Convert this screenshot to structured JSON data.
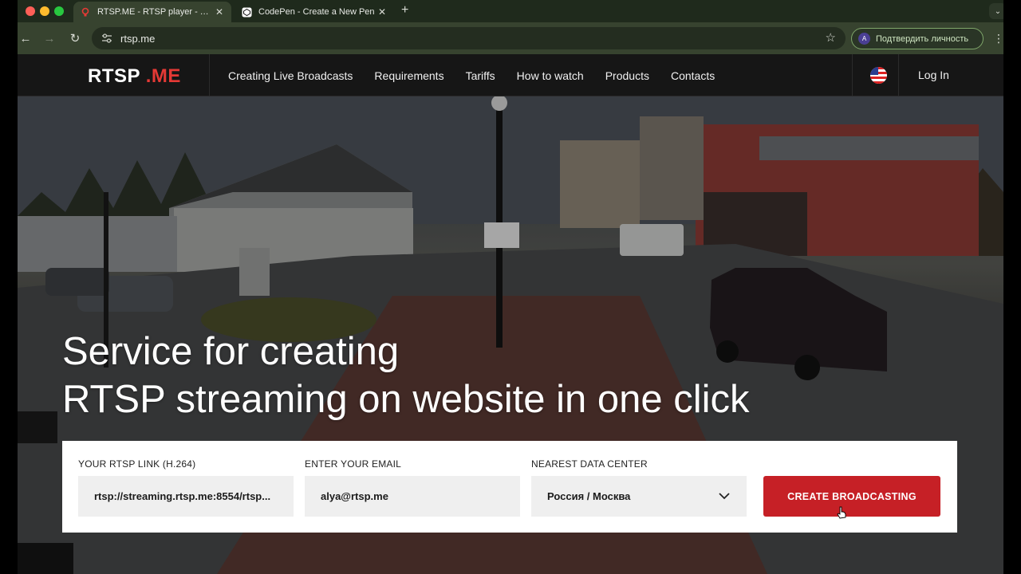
{
  "browser": {
    "tabs": [
      {
        "title": "RTSP.ME - RTSP player - The",
        "favicon": "rtspme-favicon-icon",
        "active": true
      },
      {
        "title": "CodePen - Create a New Pen",
        "favicon": "codepen-favicon-icon",
        "active": false
      }
    ],
    "url": "rtsp.me",
    "profile_button": "Подтвердить личность",
    "profile_initial": "A"
  },
  "site": {
    "logo_part1": "RTSP",
    "logo_part2": ".ME",
    "nav": [
      "Creating Live Broadcasts",
      "Requirements",
      "Tariffs",
      "How to watch",
      "Products",
      "Contacts"
    ],
    "login": "Log In",
    "language_flag": "us-flag-icon"
  },
  "hero": {
    "title_line1": "Service for creating",
    "title_line2": "RTSP streaming on website in one click"
  },
  "form": {
    "rtsp_label": "YOUR RTSP LINK (H.264)",
    "rtsp_value": "rtsp://streaming.rtsp.me:8554/rtsp...",
    "email_label": "ENTER YOUR EMAIL",
    "email_value": "alya@rtsp.me",
    "datacenter_label": "NEAREST DATA CENTER",
    "datacenter_value": "Россия / Москва",
    "submit_label": "CREATE BROADCASTING"
  },
  "colors": {
    "brand_red": "#e53935",
    "button_red": "#c62026",
    "header_bg": "#161616"
  }
}
